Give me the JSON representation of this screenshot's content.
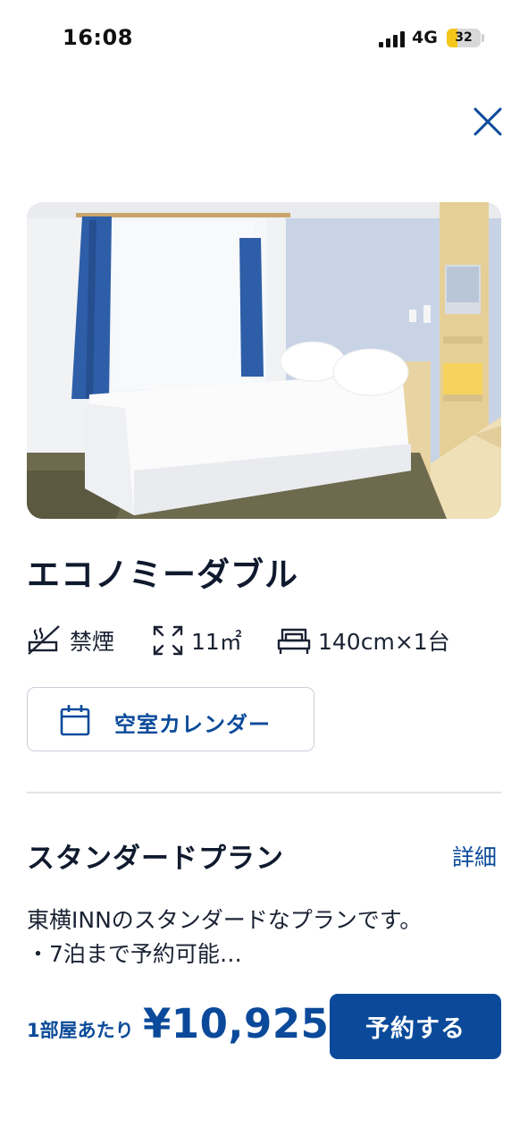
{
  "status_bar": {
    "time": "16:08",
    "network": "4G",
    "battery_level": "32",
    "battery_fraction": 0.32,
    "battery_color": "#f4c619"
  },
  "close_icon": "close-icon",
  "room": {
    "photo_alt": "room-photo",
    "name": "エコノミーダブル",
    "specs": {
      "smoking": {
        "icon": "no-smoking-icon",
        "label": "禁煙"
      },
      "size": {
        "icon": "expand-icon",
        "label": "11㎡"
      },
      "bed": {
        "icon": "bed-icon",
        "label": "140cm×1台"
      }
    }
  },
  "calendar_button": {
    "icon": "calendar-icon",
    "label": "空室カレンダー"
  },
  "plan": {
    "title": "スタンダードプラン",
    "detail_link": "詳細",
    "description_line1": "東横INNのスタンダードなプランです。",
    "description_line2": "・7泊まで予約可能…"
  },
  "pricing": {
    "unit_label": "1部屋あたり",
    "price": "¥10,925",
    "reserve_label": "予約する"
  },
  "colors": {
    "brand_blue": "#0b4a9a",
    "text_dark": "#101a2e",
    "border": "#c9d0da"
  }
}
